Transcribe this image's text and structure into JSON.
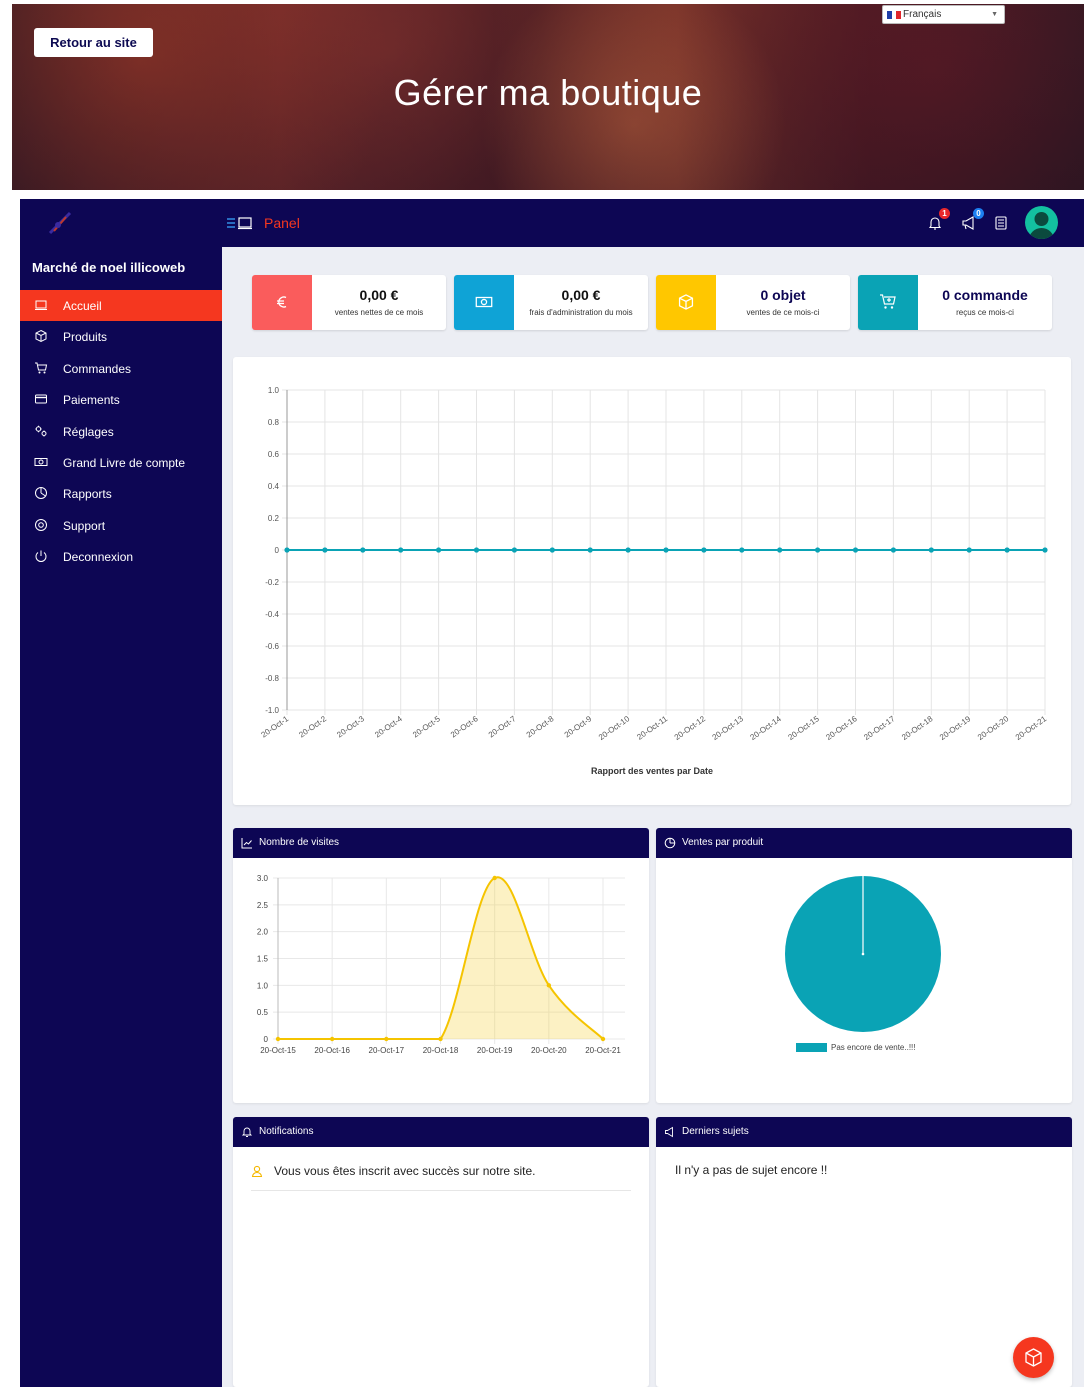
{
  "hero": {
    "title": "Gérer ma boutique",
    "back_label": "Retour au site",
    "language": "Français"
  },
  "sidebar": {
    "shop_name": "Marché de noel illicoweb",
    "items": [
      {
        "label": "Accueil",
        "icon": "laptop-icon",
        "active": true
      },
      {
        "label": "Produits",
        "icon": "box-icon"
      },
      {
        "label": "Commandes",
        "icon": "cart-icon"
      },
      {
        "label": "Paiements",
        "icon": "credit-card-icon"
      },
      {
        "label": "Réglages",
        "icon": "gears-icon"
      },
      {
        "label": "Grand Livre de compte",
        "icon": "money-icon"
      },
      {
        "label": "Rapports",
        "icon": "pie-chart-icon"
      },
      {
        "label": "Support",
        "icon": "lifebuoy-icon"
      },
      {
        "label": "Deconnexion",
        "icon": "power-icon"
      }
    ]
  },
  "topbar": {
    "panel_label": "Panel",
    "notifications_count": "1",
    "announcements_count": "0"
  },
  "stats": [
    {
      "value": "0,00 €",
      "label": "ventes nettes de ce mois",
      "icon": "euro-icon",
      "color": "#fa5c5c"
    },
    {
      "value": "0,00 €",
      "label": "frais d'administration du mois",
      "icon": "money-icon",
      "color": "#0fa3d6"
    },
    {
      "value": "0 objet",
      "label": "ventes de ce mois-ci",
      "icon": "box-icon",
      "color": "#ffc700"
    },
    {
      "value": "0 commande",
      "label": "reçus ce mois-ci",
      "icon": "cart-plus-icon",
      "color": "#0aa3b5"
    }
  ],
  "colors": {
    "navy": "#0d0654",
    "accent_red": "#f5371f",
    "sales_line": "#0aa3b5",
    "visits_line": "#f5c400",
    "pie": "#0aa3b5",
    "stat_value": "#0d0654"
  },
  "cards": {
    "visits_title": "Nombre de visites",
    "pie_title": "Ventes par produit",
    "notifications_title": "Notifications",
    "topics_title": "Derniers sujets",
    "notification_text": "Vous vous êtes inscrit avec succès sur notre site.",
    "topics_empty": "Il n'y a pas de sujet encore !!"
  },
  "chart_data": [
    {
      "type": "line",
      "title": "Rapport des ventes par Date",
      "x": [
        "20-Oct-1",
        "20-Oct-2",
        "20-Oct-3",
        "20-Oct-4",
        "20-Oct-5",
        "20-Oct-6",
        "20-Oct-7",
        "20-Oct-8",
        "20-Oct-9",
        "20-Oct-10",
        "20-Oct-11",
        "20-Oct-12",
        "20-Oct-13",
        "20-Oct-14",
        "20-Oct-15",
        "20-Oct-16",
        "20-Oct-17",
        "20-Oct-18",
        "20-Oct-19",
        "20-Oct-20",
        "20-Oct-21"
      ],
      "series": [
        {
          "values": [
            0,
            0,
            0,
            0,
            0,
            0,
            0,
            0,
            0,
            0,
            0,
            0,
            0,
            0,
            0,
            0,
            0,
            0,
            0,
            0,
            0
          ]
        }
      ],
      "y_ticks": [
        "1.0",
        "0.8",
        "0.6",
        "0.4",
        "0.2",
        "0",
        "-0.2",
        "-0.4",
        "-0.6",
        "-0.8",
        "-1.0"
      ],
      "ylim": [
        -1,
        1
      ],
      "grid": true
    },
    {
      "type": "area",
      "x": [
        "20-Oct-15",
        "20-Oct-16",
        "20-Oct-17",
        "20-Oct-18",
        "20-Oct-19",
        "20-Oct-20",
        "20-Oct-21"
      ],
      "series": [
        {
          "values": [
            0,
            0,
            0,
            0,
            3,
            1,
            0
          ]
        }
      ],
      "y_ticks": [
        "3.0",
        "2.5",
        "2.0",
        "1.5",
        "1.0",
        "0.5",
        "0"
      ],
      "ylim": [
        0,
        3
      ],
      "grid": true
    },
    {
      "type": "pie",
      "categories": [
        "Pas encore de vente..!!!"
      ],
      "values": [
        1
      ],
      "legend": "bottom"
    }
  ]
}
